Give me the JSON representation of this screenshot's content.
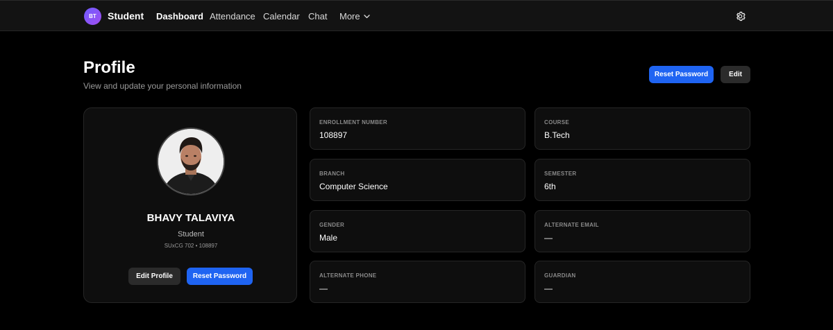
{
  "app": {
    "avatar_initials": "BT",
    "brand": "Student",
    "nav": [
      "Dashboard",
      "Attendance",
      "Calendar",
      "Chat"
    ],
    "nav_more": "More",
    "accent": "#1f64f2"
  },
  "header": {
    "title": "Profile",
    "subtitle": "View and update your personal information",
    "reset_password": "Reset Password",
    "edit": "Edit"
  },
  "profile": {
    "name": "BHAVY TALAVIYA",
    "role": "Student",
    "meta": "SUxCG 702 • 108897",
    "edit_profile": "Edit Profile",
    "reset_password": "Reset Password"
  },
  "fields": [
    {
      "label": "ENROLLMENT NUMBER",
      "value": "108897"
    },
    {
      "label": "COURSE",
      "value": "B.Tech"
    },
    {
      "label": "BRANCH",
      "value": "Computer Science"
    },
    {
      "label": "SEMESTER",
      "value": "6th"
    },
    {
      "label": "GENDER",
      "value": "Male"
    },
    {
      "label": "ALTERNATE EMAIL",
      "value": "—"
    },
    {
      "label": "ALTERNATE PHONE",
      "value": "—"
    },
    {
      "label": "GUARDIAN",
      "value": "—"
    }
  ]
}
